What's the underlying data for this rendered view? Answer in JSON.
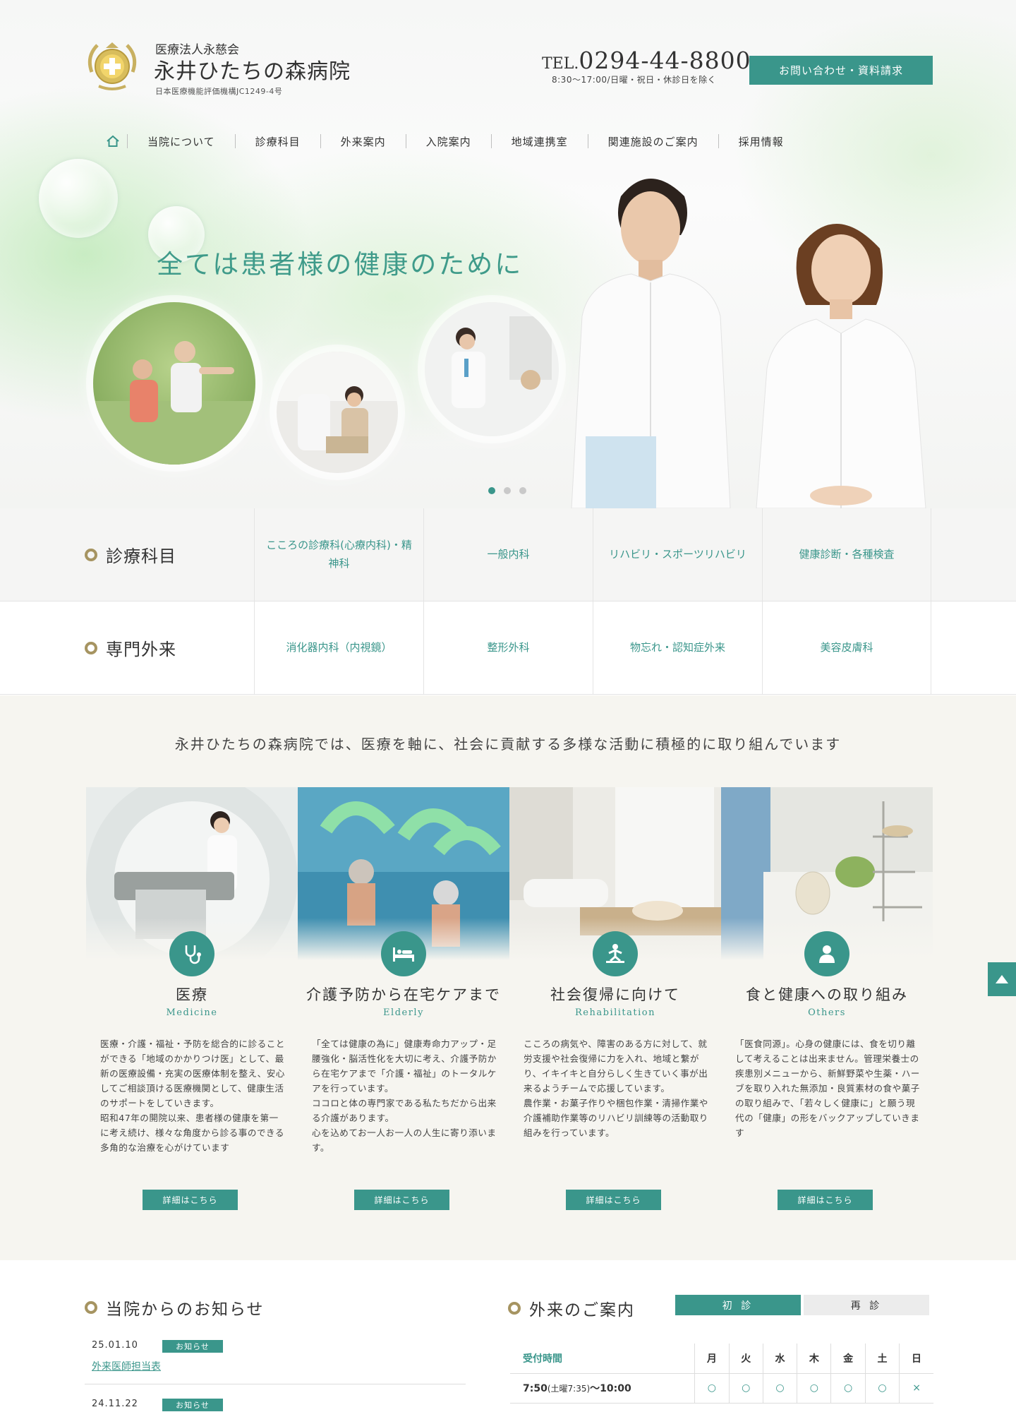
{
  "header": {
    "corp_name": "医療法人永慈会",
    "hospital_name": "永井ひたちの森病院",
    "accreditation": "日本医療機能評価機構JC1249-4号",
    "tel_prefix": "TEL.",
    "tel_number": "0294-44-8800",
    "hours": "8:30〜17:00/日曜・祝日・休診日を除く",
    "contact_button": "お問い合わせ・資料請求"
  },
  "nav": {
    "home_icon": "home-icon",
    "items": [
      "当院について",
      "診療科目",
      "外来案内",
      "入院案内",
      "地域連携室",
      "関連施設のご案内",
      "採用情報"
    ]
  },
  "hero": {
    "catchphrase": "全ては患者様の健康のために",
    "slide_count": 3,
    "active_slide": 1
  },
  "departments": {
    "row1": {
      "title": "診療科目",
      "cells": [
        "こころの診療科(心療内科)・精神科",
        "一般内科",
        "リハビリ・スポーツリハビリ",
        "健康診断・各種検査"
      ]
    },
    "row2": {
      "title": "専門外来",
      "cells": [
        "消化器内科（内視鏡）",
        "整形外科",
        "物忘れ・認知症外来",
        "美容皮膚科"
      ]
    }
  },
  "activities": {
    "lead": "永井ひたちの森病院では、医療を軸に、社会に貢献する多様な活動に積極的に取り組んでいます",
    "more_label": "詳細はこちら",
    "cards": [
      {
        "title": "医療",
        "en": "Medicine",
        "icon": "stethoscope-icon",
        "body": "医療・介護・福祉・予防を総合的に診ることができる「地域のかかりつけ医」として、最新の医療設備・充実の医療体制を整え、安心してご相談頂ける医療機関として、健康生活のサポートをしていきます。\n昭和47年の開院以来、患者様の健康を第一に考え続け、様々な角度から診る事のできる多角的な治療を心がけています"
      },
      {
        "title": "介護予防から在宅ケアまで",
        "en": "Elderly",
        "icon": "bed-care-icon",
        "body": "「全ては健康の為に」健康寿命力アップ・足腰強化・脳活性化を大切に考え、介護予防から在宅ケアまで「介護・福祉」のトータルケアを行っています。\nココロと体の専門家である私たちだから出来る介護があります。\n心を込めてお一人お一人の人生に寄り添います。"
      },
      {
        "title": "社会復帰に向けて",
        "en": "Rehabilitation",
        "icon": "rehabilitation-icon",
        "body": "こころの病気や、障害のある方に対して、就労支援や社会復帰に力を入れ、地域と繋がり、イキイキと自分らしく生きていく事が出来るようチームで応援しています。\n農作業・お菓子作りや梱包作業・清掃作業や介護補助作業等のリハビリ訓練等の活動取り組みを行っています。"
      },
      {
        "title": "食と健康への取り組み",
        "en": "Others",
        "icon": "person-icon",
        "body": "「医食同源」。心身の健康には、食を切り離して考えることは出来ません。管理栄養士の疾患別メニューから、新鮮野菜や生薬・ハーブを取り入れた無添加・良質素材の食や菓子の取り組みで、「若々しく健康に」と願う現代の「健康」の形をバックアップしていきます"
      }
    ]
  },
  "news": {
    "title": "当院からのお知らせ",
    "items": [
      {
        "date": "25.01.10",
        "category": "お知らせ",
        "title": "外来医師担当表"
      },
      {
        "date": "24.11.22",
        "category": "お知らせ",
        "title": ""
      }
    ]
  },
  "outpatient": {
    "title": "外来のご案内",
    "tabs": [
      "初 診",
      "再 診"
    ],
    "active_tab": 0,
    "header_label": "受付時間",
    "days": [
      "月",
      "火",
      "水",
      "木",
      "金",
      "土",
      "日"
    ],
    "rows": [
      {
        "time": "7:50",
        "note": "(土曜7:35)",
        "time_end": "〜10:00",
        "marks": [
          "○",
          "○",
          "○",
          "○",
          "○",
          "○",
          "×"
        ]
      }
    ]
  },
  "colors": {
    "accent": "#3a968b",
    "gold": "#a69461",
    "beige": "#f6f5f0"
  }
}
